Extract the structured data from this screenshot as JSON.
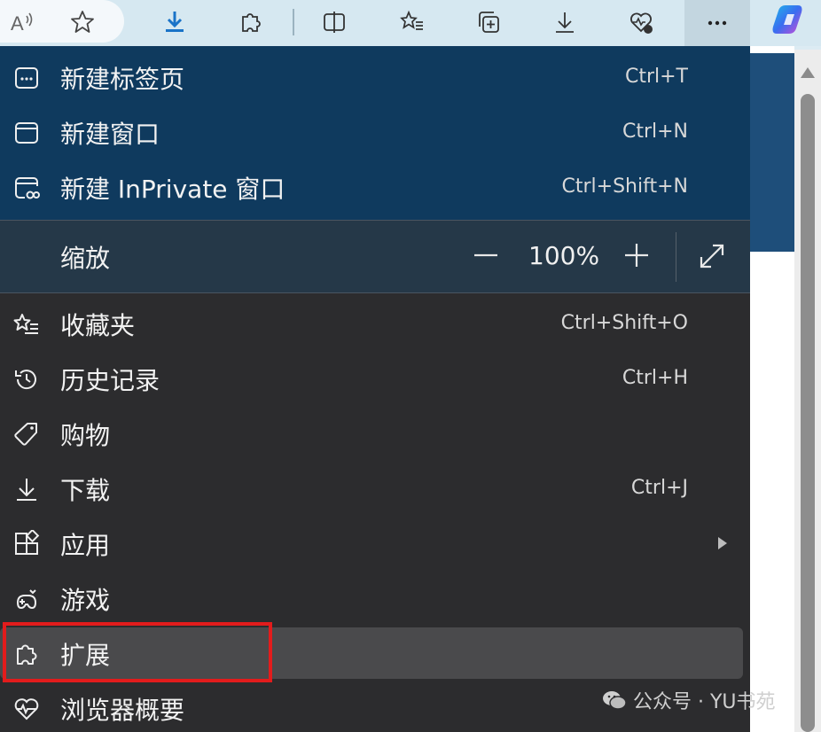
{
  "toolbar": {
    "buttons": [
      {
        "name": "read-aloud-icon",
        "label": "A"
      },
      {
        "name": "favorite-star-icon"
      },
      {
        "name": "download-arrow-icon"
      },
      {
        "name": "extensions-puzzle-icon"
      },
      {
        "name": "split-screen-icon"
      },
      {
        "name": "favorites-list-icon"
      },
      {
        "name": "collections-icon"
      },
      {
        "name": "downloads-icon"
      },
      {
        "name": "browser-essentials-icon"
      },
      {
        "name": "more-menu-icon",
        "label": "···"
      },
      {
        "name": "copilot-icon"
      }
    ]
  },
  "menu": {
    "items": [
      {
        "label": "新建标签页",
        "shortcut": "Ctrl+T",
        "icon": "new-tab-icon"
      },
      {
        "label": "新建窗口",
        "shortcut": "Ctrl+N",
        "icon": "new-window-icon"
      },
      {
        "label": "新建 InPrivate 窗口",
        "shortcut": "Ctrl+Shift+N",
        "icon": "inprivate-icon"
      },
      {
        "label": "收藏夹",
        "shortcut": "Ctrl+Shift+O",
        "icon": "favorites-icon"
      },
      {
        "label": "历史记录",
        "shortcut": "Ctrl+H",
        "icon": "history-icon"
      },
      {
        "label": "购物",
        "shortcut": "",
        "icon": "shopping-tag-icon"
      },
      {
        "label": "下载",
        "shortcut": "Ctrl+J",
        "icon": "download-icon"
      },
      {
        "label": "应用",
        "shortcut": "",
        "icon": "apps-icon"
      },
      {
        "label": "游戏",
        "shortcut": "",
        "icon": "games-icon"
      },
      {
        "label": "扩展",
        "shortcut": "",
        "icon": "extensions-icon"
      },
      {
        "label": "浏览器概要",
        "shortcut": "",
        "icon": "browser-essentials-icon"
      }
    ],
    "zoom": {
      "label": "缩放",
      "value": "100%",
      "minus": "—",
      "plus": "+"
    }
  },
  "watermark": {
    "text": "公众号 · YU书苑"
  },
  "colors": {
    "menu_bg": "#2c2c2e",
    "menu_top_bg": "#0f3a5e",
    "highlight_box": "#e21c1c",
    "toolbar_bg": "#d6e8f1"
  }
}
